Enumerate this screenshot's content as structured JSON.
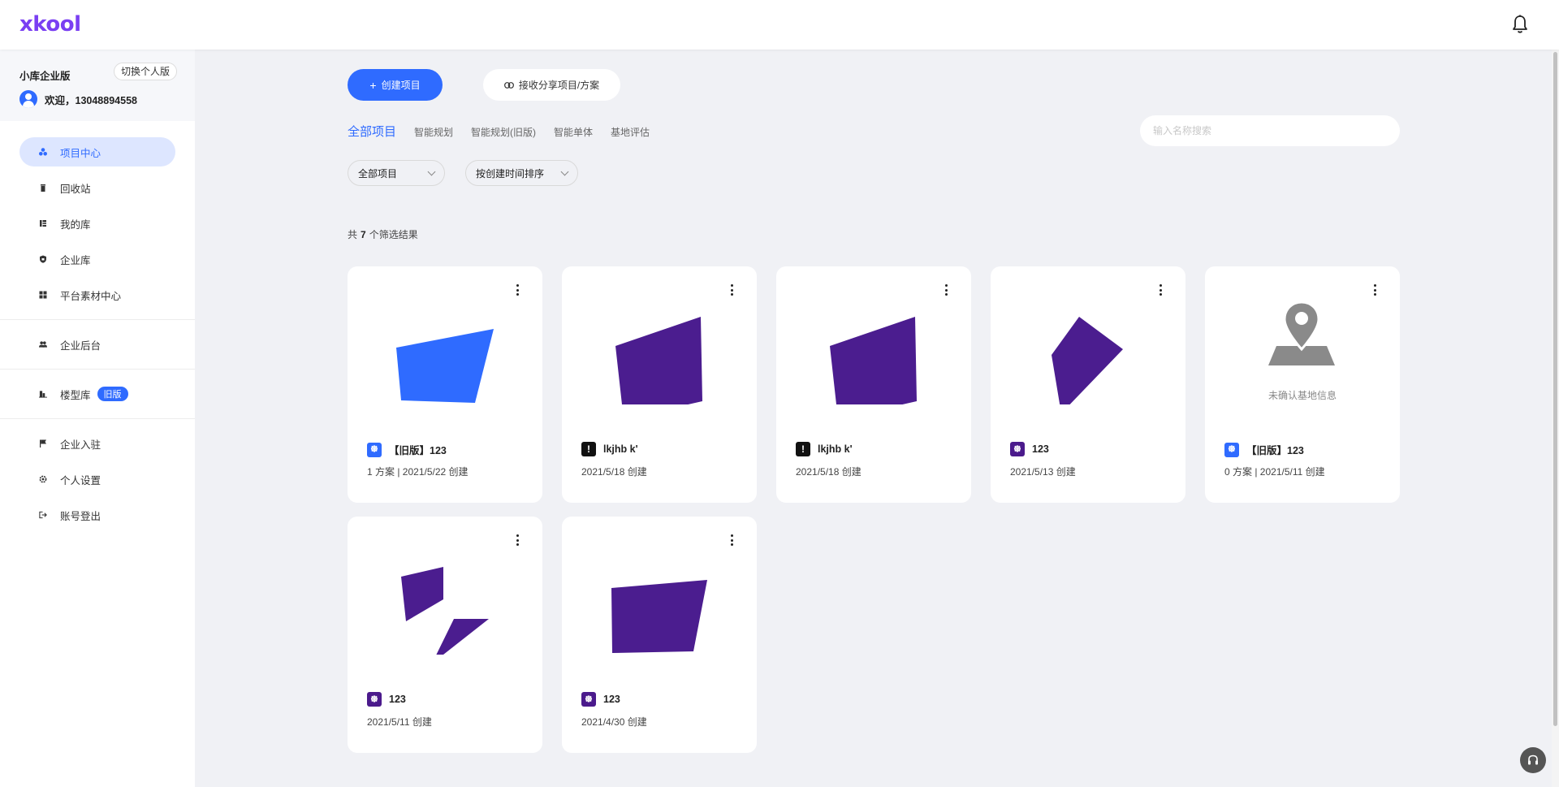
{
  "header": {
    "logo": "xkool"
  },
  "sidebar": {
    "enterprise_name": "小库企业版",
    "switch_label": "切换个人版",
    "welcome": "欢迎，13048894558",
    "items": [
      {
        "label": "项目中心",
        "icon": "projects-icon"
      },
      {
        "label": "回收站",
        "icon": "trash-icon"
      },
      {
        "label": "我的库",
        "icon": "my-library-icon"
      },
      {
        "label": "企业库",
        "icon": "enterprise-library-icon"
      },
      {
        "label": "平台素材中心",
        "icon": "grid-icon"
      },
      {
        "label": "企业后台",
        "icon": "users-icon"
      },
      {
        "label": "楼型库",
        "icon": "building-icon",
        "badge": "旧版"
      },
      {
        "label": "企业入驻",
        "icon": "flag-icon"
      },
      {
        "label": "个人设置",
        "icon": "settings-icon"
      },
      {
        "label": "账号登出",
        "icon": "logout-icon"
      }
    ]
  },
  "main": {
    "create_label": "创建项目",
    "share_label": "接收分享项目/方案",
    "tabs": [
      "全部项目",
      "智能规划",
      "智能规划(旧版)",
      "智能单体",
      "基地评估"
    ],
    "search_placeholder": "输入名称搜索",
    "filter_select": "全部项目",
    "sort_select": "按创建时间排序",
    "result_prefix": "共",
    "result_count": "7",
    "result_suffix": "个筛选结果"
  },
  "projects": [
    {
      "title": "【旧版】123",
      "meta": "1 方案 | 2021/5/22 创建",
      "icon_glyph": "᪥",
      "icon_color": "blue",
      "shape_color": "#2f6bff"
    },
    {
      "title": "lkjhb k'",
      "meta": "2021/5/18 创建",
      "icon_glyph": "ǃ",
      "icon_color": "black",
      "shape_color": "#4b1d8f"
    },
    {
      "title": "lkjhb k'",
      "meta": "2021/5/18 创建",
      "icon_glyph": "ǃ",
      "icon_color": "black",
      "shape_color": "#4b1d8f"
    },
    {
      "title": "123",
      "meta": "2021/5/13 创建",
      "icon_glyph": "᪥",
      "icon_color": "purple",
      "shape_color": "#4b1d8f"
    },
    {
      "title": "【旧版】123",
      "meta": "0 方案 | 2021/5/11 创建",
      "icon_glyph": "᪥",
      "icon_color": "blue",
      "unconfirmed_text": "未确认基地信息"
    },
    {
      "title": "123",
      "meta": "2021/5/11 创建",
      "icon_glyph": "᪥",
      "icon_color": "purple",
      "shape_color": "#4b1d8f"
    },
    {
      "title": "123",
      "meta": "2021/4/30 创建",
      "icon_glyph": "᪥",
      "icon_color": "purple",
      "shape_color": "#4b1d8f"
    }
  ]
}
